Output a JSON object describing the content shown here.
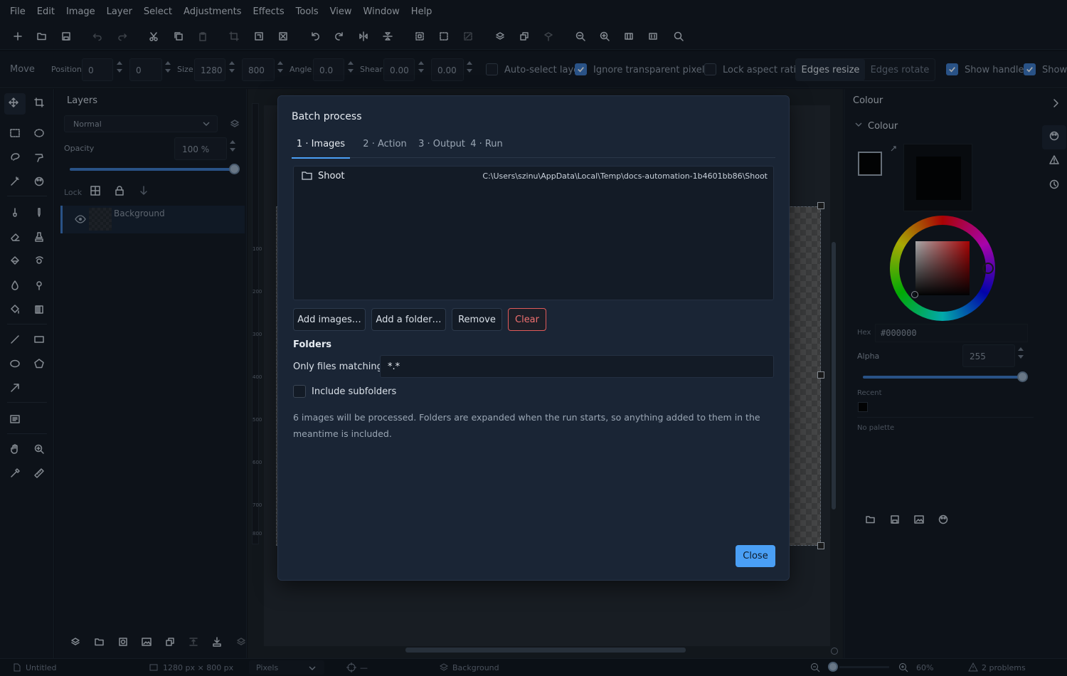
{
  "menu": [
    "File",
    "Edit",
    "Image",
    "Layer",
    "Select",
    "Adjustments",
    "Effects",
    "Tools",
    "View",
    "Window",
    "Help"
  ],
  "options": {
    "tool_name": "Move",
    "position_label": "Position",
    "position_x": "0",
    "position_y": "0",
    "size_label": "Size",
    "size_w": "1280",
    "size_h": "800",
    "angle_label": "Angle",
    "angle": "0.0",
    "shear_label": "Shear",
    "shear_x": "0.00",
    "shear_y": "0.00",
    "auto_select": "Auto-select layer",
    "ignore_transparent": "Ignore transparent pixels",
    "lock_aspect": "Lock aspect ratio",
    "edges_resize": "Edges resize",
    "edges_rotate": "Edges rotate",
    "show_handles": "Show handles",
    "show_more": "Show"
  },
  "layers": {
    "title": "Layers",
    "blend_mode": "Normal",
    "opacity_label": "Opacity",
    "opacity_value": "100 %",
    "opacity_fraction": 1.0,
    "lock_label": "Lock",
    "items": [
      {
        "name": "Background"
      }
    ]
  },
  "canvas": {
    "ruler_ticks": [
      "100",
      "200",
      "300",
      "400",
      "500",
      "600",
      "700",
      "800"
    ]
  },
  "colour": {
    "panel_title": "Colour",
    "section_title": "Colour",
    "hex_label": "Hex",
    "hex_value": "#000000",
    "alpha_label": "Alpha",
    "alpha_value": "255",
    "recent_label": "Recent",
    "palette_text": "No palette"
  },
  "status": {
    "doc_name": "Untitled",
    "doc_size": "1280 px × 800 px",
    "units": "Pixels",
    "cursor_pos": "—",
    "layer": "Background",
    "zoom": "60%",
    "problems": "2 problems"
  },
  "dialog": {
    "title": "Batch process",
    "tabs": [
      "1 · Images",
      "2 · Action",
      "3 · Output",
      "4 · Run"
    ],
    "active_tab": 0,
    "list": [
      {
        "name": "Shoot",
        "path": "C:\\Users\\szinu\\AppData\\Local\\Temp\\docs-automation-1b4601bb86\\Shoot"
      }
    ],
    "buttons": {
      "add_images": "Add images…",
      "add_folder": "Add a folder…",
      "remove": "Remove",
      "clear": "Clear"
    },
    "folders_heading": "Folders",
    "match_label": "Only files matching",
    "match_value": "*.*",
    "include_subfolders": "Include subfolders",
    "info": "6 images will be processed.  Folders are expanded when the run starts, so anything added to them in the meantime is included.",
    "close": "Close"
  },
  "colors": {
    "accent": "#4a9ff5",
    "danger": "#e05a5a",
    "panel_bg": "#111821",
    "dialog_bg": "#1a2535"
  }
}
